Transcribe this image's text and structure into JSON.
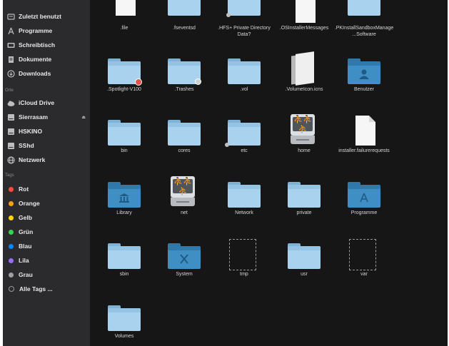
{
  "sidebar": {
    "section_favorites": "",
    "favorites": [
      {
        "label": "Zuletzt benutzt",
        "icon": "recent-icon"
      },
      {
        "label": "Programme",
        "icon": "applications-icon"
      },
      {
        "label": "Schreibtisch",
        "icon": "desktop-icon"
      },
      {
        "label": "Dokumente",
        "icon": "documents-icon"
      },
      {
        "label": "Downloads",
        "icon": "downloads-icon"
      }
    ],
    "section_locations": "Orte",
    "locations": [
      {
        "label": "iCloud Drive",
        "icon": "cloud-icon"
      },
      {
        "label": "Sierrasam",
        "icon": "disk-icon",
        "eject": "⏏"
      },
      {
        "label": "HSKINO",
        "icon": "disk-icon"
      },
      {
        "label": "SShd",
        "icon": "disk-icon"
      },
      {
        "label": "Netzwerk",
        "icon": "network-icon"
      }
    ],
    "section_tags": "Tags",
    "tags": [
      {
        "label": "Rot",
        "color": "#ff4a3d"
      },
      {
        "label": "Orange",
        "color": "#ff9f0a"
      },
      {
        "label": "Gelb",
        "color": "#ffd60a"
      },
      {
        "label": "Grün",
        "color": "#32d74b"
      },
      {
        "label": "Blau",
        "color": "#0a84ff"
      },
      {
        "label": "Lila",
        "color": "#9b6bff"
      },
      {
        "label": "Grau",
        "color": "#a0a0a0"
      },
      {
        "label": "Alle Tags ...",
        "color": ""
      }
    ]
  },
  "files": {
    "row0": [
      {
        "label": ".file",
        "kind": "document"
      },
      {
        "label": ".fseventsd",
        "kind": "folder"
      },
      {
        "label": ".HFS+ Private Directory Data?",
        "kind": "folder-alias"
      },
      {
        "label": ".OSInstallerMessages",
        "kind": "document"
      },
      {
        "label": ".PKInstallSandboxManage...Software",
        "kind": "folder"
      }
    ],
    "row1": [
      {
        "label": ".Spotlight-V100",
        "kind": "folder-red-badge"
      },
      {
        "label": ".Trashes",
        "kind": "folder-gray-badge"
      },
      {
        "label": ".vol",
        "kind": "folder"
      },
      {
        "label": ".VolumeIcon.icns",
        "kind": "icns-file"
      },
      {
        "label": "Benutzer",
        "kind": "users-folder"
      }
    ],
    "row2": [
      {
        "label": "bin",
        "kind": "folder"
      },
      {
        "label": "cores",
        "kind": "folder"
      },
      {
        "label": "etc",
        "kind": "folder-alias"
      },
      {
        "label": "home",
        "kind": "network-drive"
      },
      {
        "label": "installer.failurerequests",
        "kind": "document"
      }
    ],
    "row3": [
      {
        "label": "Library",
        "kind": "library-folder"
      },
      {
        "label": "net",
        "kind": "network-drive"
      },
      {
        "label": "Network",
        "kind": "folder"
      },
      {
        "label": "private",
        "kind": "folder"
      },
      {
        "label": "Programme",
        "kind": "applications-folder"
      }
    ],
    "row4": [
      {
        "label": "sbin",
        "kind": "folder"
      },
      {
        "label": "System",
        "kind": "system-folder"
      },
      {
        "label": "tmp",
        "kind": "alias-placeholder"
      },
      {
        "label": "usr",
        "kind": "folder"
      },
      {
        "label": "var",
        "kind": "alias-placeholder"
      }
    ],
    "row5": [
      {
        "label": "Volumes",
        "kind": "folder"
      }
    ]
  }
}
